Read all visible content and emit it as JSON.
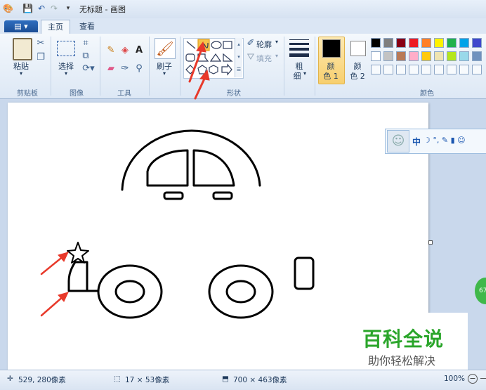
{
  "window": {
    "title": "无标题 - 画图"
  },
  "tabs": {
    "file": "▤ ▾",
    "home": "主页",
    "view": "查看"
  },
  "ribbon": {
    "clipboard": {
      "paste": "粘贴",
      "group": "剪贴板"
    },
    "image": {
      "select": "选择",
      "group": "图像"
    },
    "tools": {
      "group": "工具"
    },
    "brushes": {
      "label": "刷子"
    },
    "shapes": {
      "outline": "轮廓",
      "fill": "填充",
      "group": "形状"
    },
    "size": {
      "label_line1": "粗",
      "label_line2": "细"
    },
    "color1": {
      "line1": "颜",
      "line2": "色 1"
    },
    "color2": {
      "line1": "颜",
      "line2": "色 2"
    },
    "colors": {
      "group": "颜色"
    }
  },
  "palette_top": [
    "#000000",
    "#7f7f7f",
    "#880015",
    "#ed1c24",
    "#ff7f27",
    "#fff200",
    "#22b14c",
    "#00a2e8",
    "#3f48cc"
  ],
  "palette_mid": [
    "#ffffff",
    "#c3c3c3",
    "#b97a57",
    "#ffaec9",
    "#ffc90e",
    "#efe4b0",
    "#b5e61d",
    "#99d9ea",
    "#7092be"
  ],
  "status": {
    "cursor_pos": "529, 280像素",
    "selection_size": "17 × 53像素",
    "canvas_size": "700 × 463像素",
    "zoom": "100%"
  },
  "ime": {
    "mode": "中",
    "icons": "☽ °, ✎ ▮ ☺"
  },
  "watermark": {
    "title": "百科全说",
    "subtitle": "助你轻松解决"
  },
  "side_badge": "67"
}
